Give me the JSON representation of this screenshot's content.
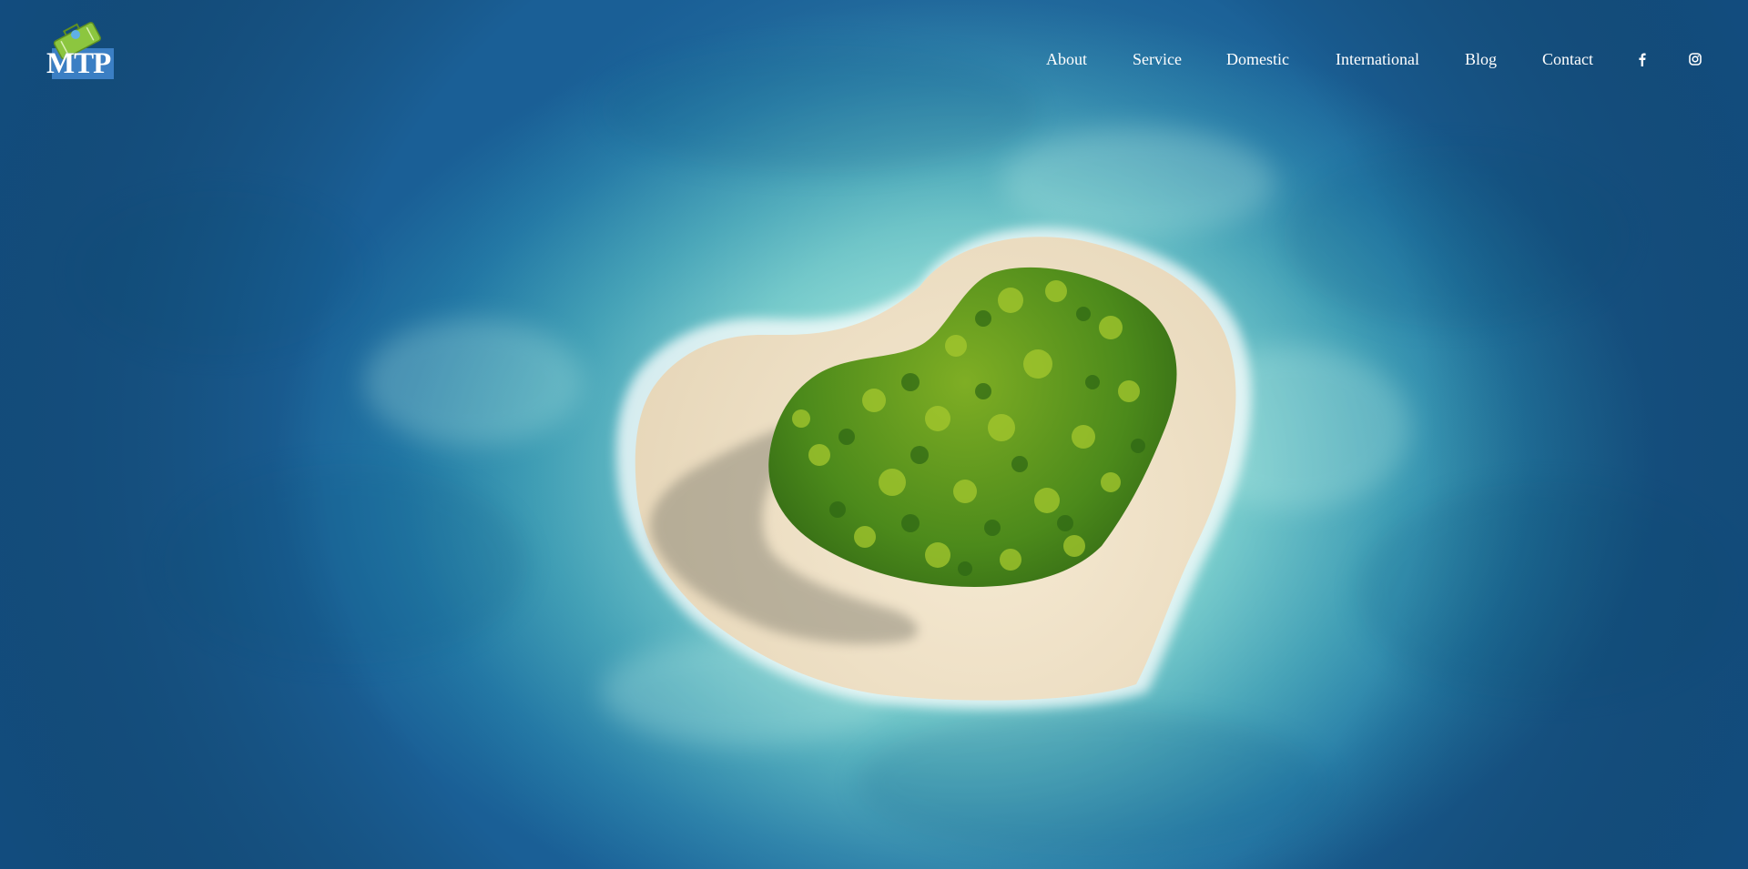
{
  "brand": {
    "logo_text": "MTP"
  },
  "nav": {
    "items": [
      {
        "label": "About"
      },
      {
        "label": "Service"
      },
      {
        "label": "Domestic"
      },
      {
        "label": "International"
      },
      {
        "label": "Blog"
      },
      {
        "label": "Contact"
      }
    ],
    "social": [
      {
        "icon": "facebook-icon"
      },
      {
        "icon": "instagram-icon"
      }
    ]
  },
  "hero": {
    "image": "heart-shaped-island-aerial"
  },
  "colors": {
    "text": "#ffffff",
    "ocean_deep": "#1a6c9c",
    "lagoon": "#8fe0d6",
    "sand": "#efe3cc",
    "foliage": "#4f8f1f",
    "logo_blue": "#3b7fc4",
    "logo_green": "#8cc63f"
  }
}
